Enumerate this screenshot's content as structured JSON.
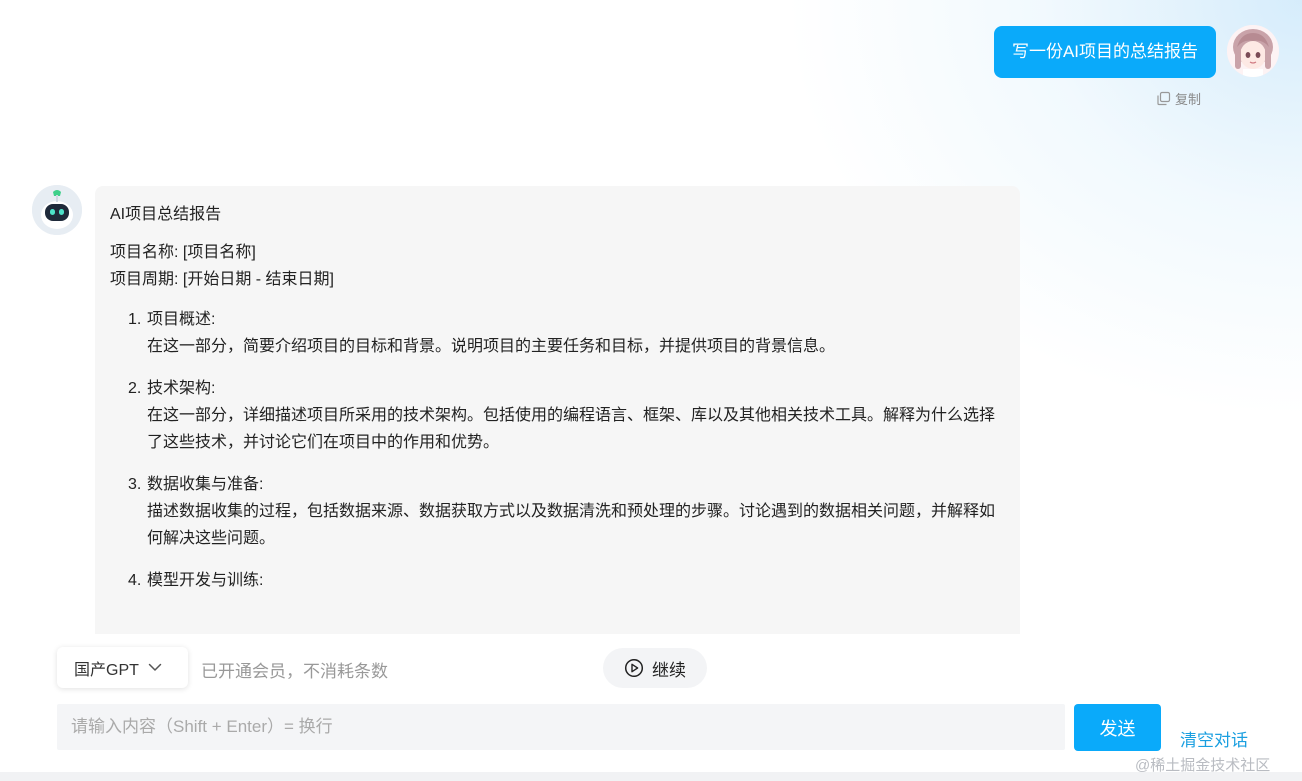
{
  "user_message": {
    "text": "写一份AI项目的总结报告",
    "copy_label": "复制"
  },
  "bot_message": {
    "title": "AI项目总结报告",
    "meta": [
      "项目名称: [项目名称]",
      "项目周期: [开始日期 - 结束日期]"
    ],
    "sections": [
      {
        "number": "1.",
        "heading": "项目概述:",
        "description": "在这一部分，简要介绍项目的目标和背景。说明项目的主要任务和目标，并提供项目的背景信息。"
      },
      {
        "number": "2.",
        "heading": "技术架构:",
        "description": "在这一部分，详细描述项目所采用的技术架构。包括使用的编程语言、框架、库以及其他相关技术工具。解释为什么选择了这些技术，并讨论它们在项目中的作用和优势。"
      },
      {
        "number": "3.",
        "heading": "数据收集与准备:",
        "description": "描述数据收集的过程，包括数据来源、数据获取方式以及数据清洗和预处理的步骤。讨论遇到的数据相关问题，并解释如何解决这些问题。"
      },
      {
        "number": "4.",
        "heading": "模型开发与训练:",
        "description": ""
      }
    ]
  },
  "toolbar": {
    "model_label": "国产GPT",
    "member_note": "已开通会员，不消耗条数",
    "continue_label": "继续"
  },
  "composer": {
    "placeholder": "请输入内容（Shift + Enter）= 换行",
    "value": "",
    "send_label": "发送",
    "clear_label": "清空对话"
  },
  "watermark": "@稀土掘金技术社区",
  "colors": {
    "accent": "#0aaafa",
    "link": "#1a9fe0",
    "bubble_bg": "#f6f6f6"
  },
  "icons": {
    "copy": "copy-icon",
    "dropdown": "chevron-down-icon",
    "continue": "play-circle-icon",
    "user_avatar": "user-avatar",
    "bot_avatar": "robot-avatar"
  }
}
